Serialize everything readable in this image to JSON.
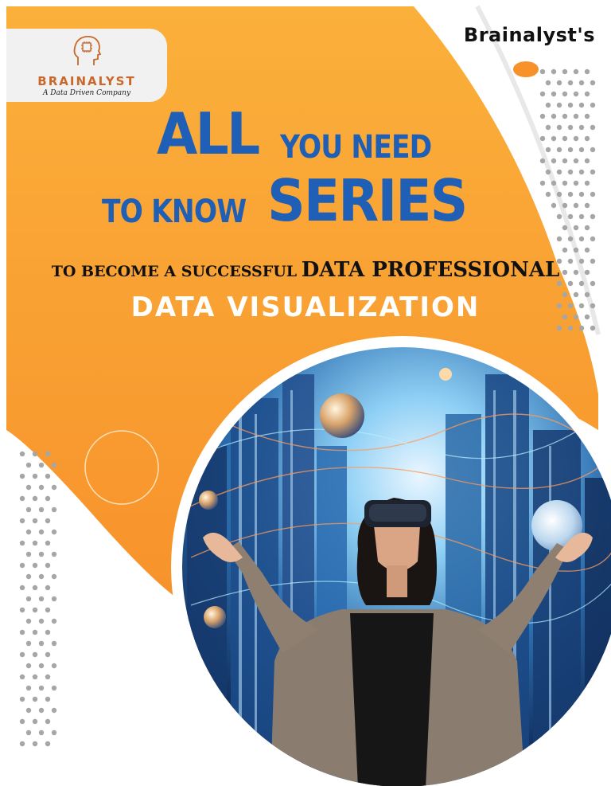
{
  "brand": {
    "name": "BRAINALYST",
    "tagline": "A Data Driven Company",
    "top_label": "Brainalyst's"
  },
  "headline": {
    "all": "ALL",
    "you_need": "YOU NEED",
    "to_know": "TO KNOW",
    "series": "SERIES"
  },
  "subheadline": {
    "lead": "TO BECOME A SUCCESSFUL",
    "emphasis": "DATA PROFESSIONAL"
  },
  "topic": "DATA VISUALIZATION",
  "colors": {
    "orange": "#f7922b",
    "orange_light": "#fbb03b",
    "headline_blue": "#1f5fb5",
    "logo_orange": "#c9682a",
    "dot_gray": "#a6a6a6"
  },
  "illustration": {
    "subject": "woman-wearing-vr-headset",
    "icon_logo": "brain-head-icon"
  }
}
